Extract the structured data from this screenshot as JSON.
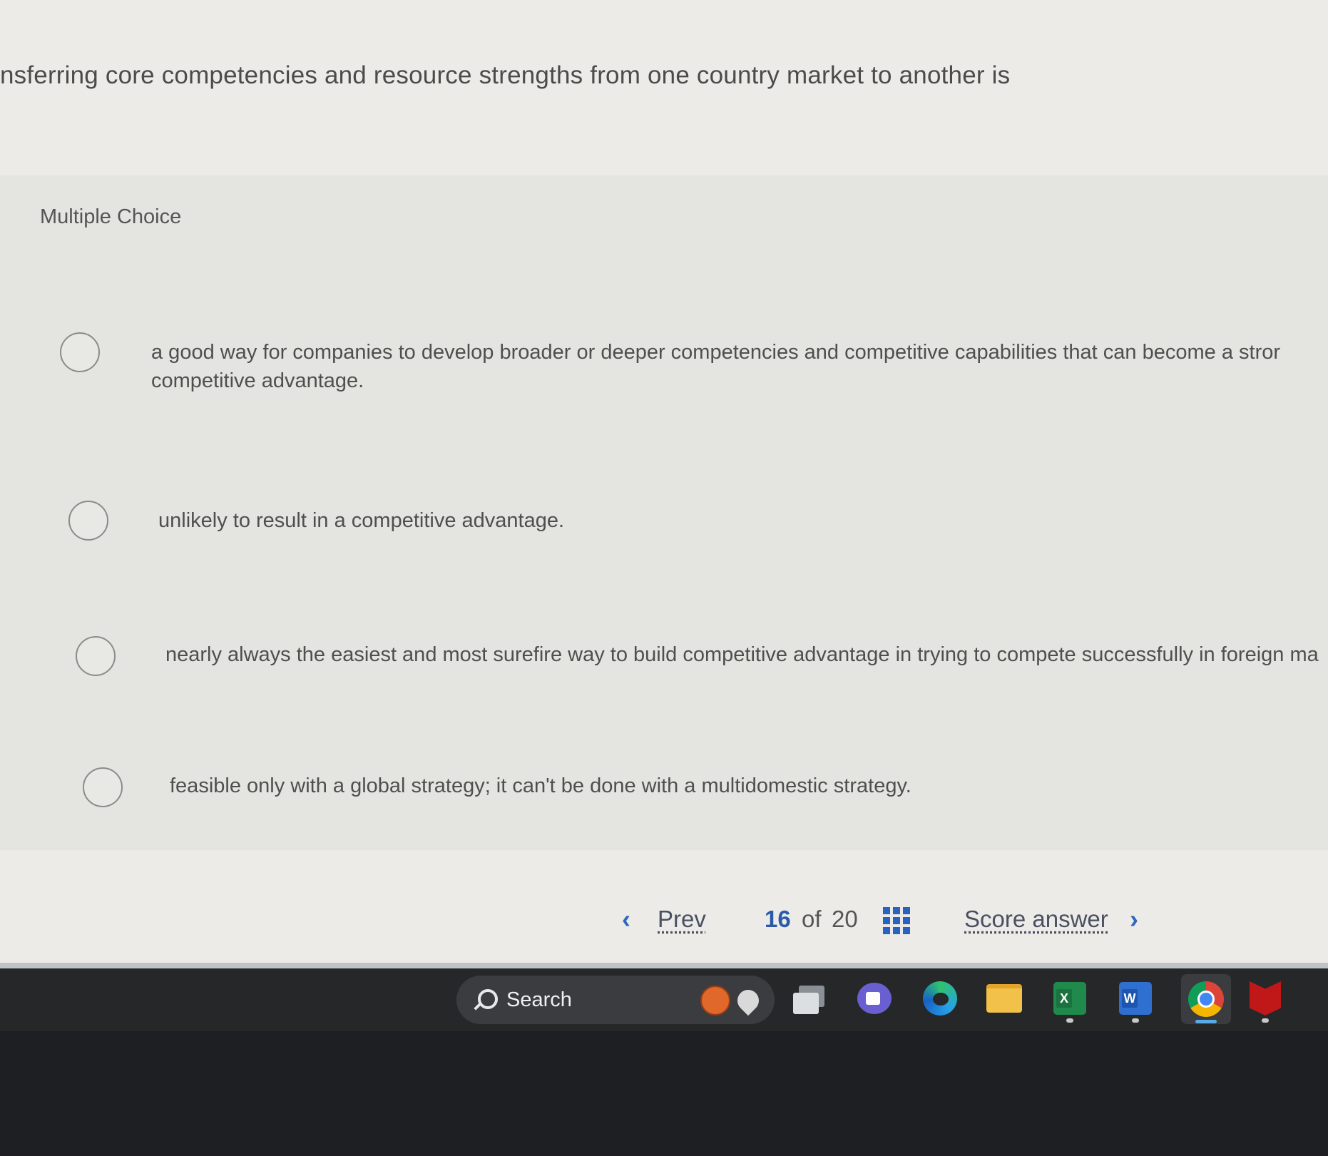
{
  "question": {
    "text": "nsferring core competencies and resource strengths from one country market to another is"
  },
  "answer_panel": {
    "type_label": "Multiple Choice",
    "options": [
      {
        "line1": "a good way for companies to develop broader or deeper competencies and competitive capabilities that can become a stror",
        "line2": "competitive advantage."
      },
      {
        "line1": "unlikely to result in a competitive advantage."
      },
      {
        "line1": "nearly always the easiest and most surefire way to build competitive advantage in trying to compete successfully in foreign ma"
      },
      {
        "line1": "feasible only with a global strategy; it can't be done with a multidomestic strategy."
      }
    ]
  },
  "navigation": {
    "prev_label": "Prev",
    "current_page": "16",
    "of_label": "of",
    "total_pages": "20",
    "score_label": "Score answer"
  },
  "taskbar": {
    "search_label": "Search",
    "icons": [
      "windows-start-icon",
      "search-icon",
      "basketball-icon",
      "pin-icon",
      "task-view-icon",
      "meet-icon",
      "edge-icon",
      "file-explorer-icon",
      "excel-icon",
      "word-icon",
      "chrome-icon",
      "mcafee-icon"
    ],
    "accent_color": "#3fa7f2"
  },
  "colors": {
    "link_blue": "#2a62c0",
    "page_background": "#ecebe8",
    "taskbar_background": "#252729"
  }
}
